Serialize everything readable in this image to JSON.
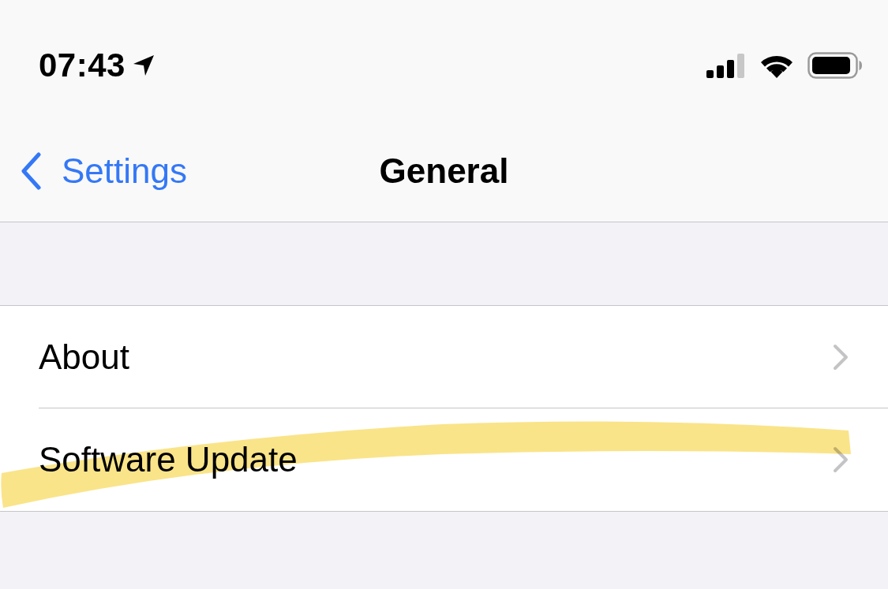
{
  "status_bar": {
    "time": "07:43"
  },
  "nav_bar": {
    "back_label": "Settings",
    "title": "General"
  },
  "rows": [
    {
      "label": "About",
      "highlighted": false
    },
    {
      "label": "Software Update",
      "highlighted": true
    }
  ]
}
